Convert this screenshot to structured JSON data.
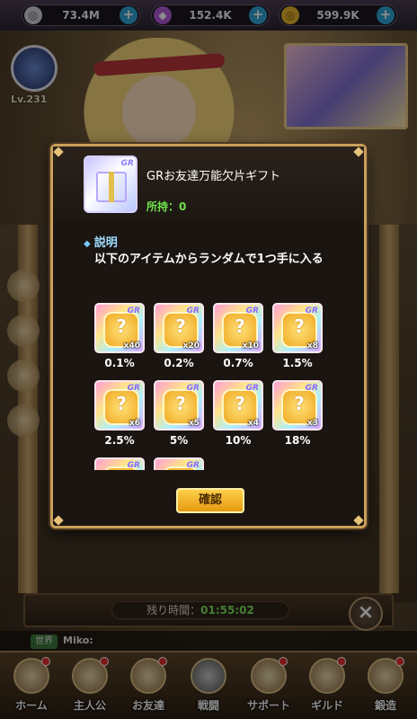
{
  "currencies": [
    {
      "icon": "silver-coin-icon",
      "value": "73.4M"
    },
    {
      "icon": "diamond-icon",
      "value": "152.4K"
    },
    {
      "icon": "gold-coin-icon",
      "value": "599.9K"
    }
  ],
  "player": {
    "level": "Lv.231"
  },
  "modal": {
    "title": "GRお友達万能欠片ギフト",
    "owned_label": "所持：0",
    "description_heading": "説明",
    "description": "以下のアイテムからランダムで1つ手に入る",
    "items": [
      {
        "qty": "x40",
        "rate": "0.1%"
      },
      {
        "qty": "x20",
        "rate": "0.2%"
      },
      {
        "qty": "x10",
        "rate": "0.7%"
      },
      {
        "qty": "x8",
        "rate": "1.5%"
      },
      {
        "qty": "x6",
        "rate": "2.5%"
      },
      {
        "qty": "x5",
        "rate": "5%"
      },
      {
        "qty": "x4",
        "rate": "10%"
      },
      {
        "qty": "x3",
        "rate": "18%"
      },
      {
        "qty": "",
        "rate": ""
      },
      {
        "qty": "",
        "rate": ""
      }
    ],
    "badge": "GR",
    "confirm_label": "確認"
  },
  "timer": {
    "label": "残り時間：",
    "value": "01:55:02"
  },
  "chat": {
    "tag": "世界",
    "name": "Miko:"
  },
  "nav": [
    {
      "label": "ホーム",
      "icon": "home-icon"
    },
    {
      "label": "主人公",
      "icon": "hero-icon"
    },
    {
      "label": "お友達",
      "icon": "friends-icon"
    },
    {
      "label": "戦闘",
      "icon": "battle-icon"
    },
    {
      "label": "サポート",
      "icon": "support-icon"
    },
    {
      "label": "ギルド",
      "icon": "guild-icon"
    },
    {
      "label": "鍛造",
      "icon": "forge-icon"
    }
  ]
}
